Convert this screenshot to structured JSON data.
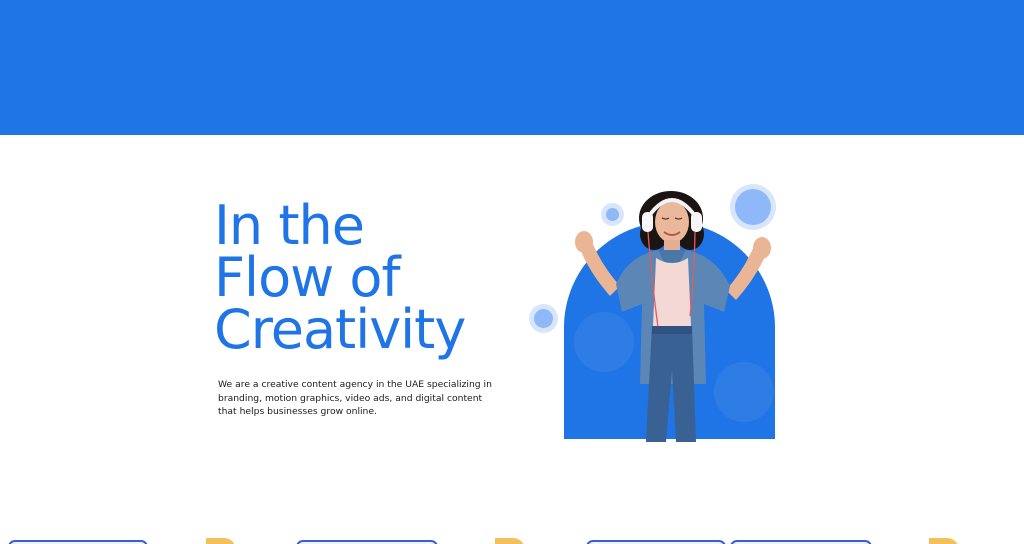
{
  "colors": {
    "brand_blue": "#1f74e6",
    "bubble_blue": "#8fb8f8",
    "text_dark": "#1a1a1a",
    "accent_yellow": "#f2c15b"
  },
  "hero": {
    "title_lines": [
      "In the",
      "Flow of",
      "Creativity"
    ],
    "description": "We are a creative content agency in the UAE specializing in branding, motion graphics, video ads, and digital content that helps businesses grow online."
  },
  "visual": {
    "image_subject": "woman-with-headphones"
  }
}
